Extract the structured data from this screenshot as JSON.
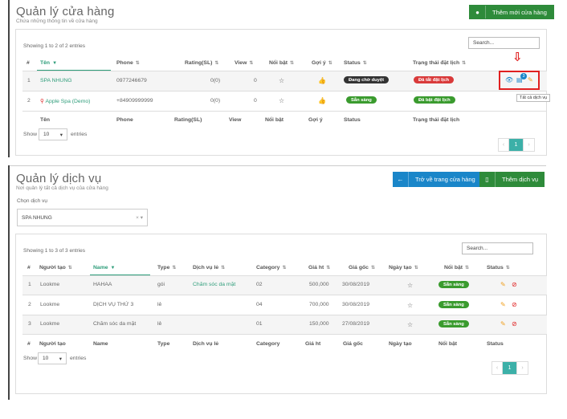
{
  "stores": {
    "title": "Quản lý cửa hàng",
    "subtitle": "Chứa những thông tin về cửa hàng",
    "add_button": "Thêm mới cửa hàng",
    "showing": "Showing 1 to 2 of 2 entries",
    "search_placeholder": "Search...",
    "columns": [
      "#",
      "Tên",
      "Phone",
      "Rating(SL)",
      "View",
      "Nổi bật",
      "Gợi ý",
      "Status",
      "Trạng thái đặt lịch"
    ],
    "rows": [
      {
        "num": "1",
        "name": "SPA NHUNG",
        "phone": "0977246679",
        "rating": "0(0)",
        "view": "0",
        "status": "Đang chờ duyệt",
        "booking": "Đã tắt đặt lịch"
      },
      {
        "num": "2",
        "name": "Apple Spa (Demo)",
        "phone": "+84909999999",
        "rating": "0(0)",
        "view": "0",
        "status": "Sẵn sàng",
        "booking": "Đã bật đặt lịch"
      }
    ],
    "tooltip": "Tất cả dịch vụ",
    "badge_count": "3",
    "show_label": "Show",
    "show_value": "10",
    "entries_label": "entries",
    "page": "1"
  },
  "services": {
    "title": "Quản lý dịch vụ",
    "subtitle": "Nơi quản lý tất cả dịch vụ của cửa hàng",
    "back_button": "Trở về trang cửa hàng",
    "add_button": "Thêm dịch vụ",
    "choose_label": "Chọn dịch vụ",
    "selected_store": "SPA NHUNG",
    "showing": "Showing 1 to 3 of 3 entries",
    "search_placeholder": "Search...",
    "columns": [
      "#",
      "Người tạo",
      "Name",
      "Type",
      "Dịch vụ lẻ",
      "Category",
      "Giá ht",
      "Giá gốc",
      "Ngày tạo",
      "Nổi bật",
      "Status"
    ],
    "rows": [
      {
        "num": "1",
        "creator": "Lookme",
        "name": "HAHAA",
        "type": "gói",
        "single": "Chăm sóc da mặt",
        "category": "02",
        "price": "500,000",
        "date": "30/08/2019",
        "status": "Sẵn sàng"
      },
      {
        "num": "2",
        "creator": "Lookme",
        "name": "DỊCH VỤ THỨ 3",
        "type": "lẻ",
        "single": "",
        "category": "04",
        "price": "700,000",
        "date": "30/08/2019",
        "status": "Sẵn sàng"
      },
      {
        "num": "3",
        "creator": "Lookme",
        "name": "Chăm sóc da mặt",
        "type": "lẻ",
        "single": "",
        "category": "01",
        "price": "150,000",
        "date": "27/08/2019",
        "status": "Sẵn sàng"
      }
    ],
    "show_label": "Show",
    "show_value": "10",
    "entries_label": "entries",
    "page": "1"
  },
  "colors": {
    "green": "#2e8b3a",
    "blue": "#1a86c9",
    "red": "#d93a3a",
    "link": "#2e9d7a"
  }
}
